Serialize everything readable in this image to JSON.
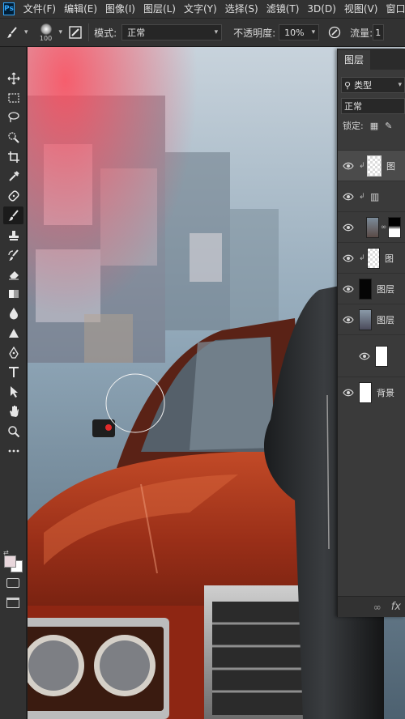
{
  "menu": [
    "文件(F)",
    "编辑(E)",
    "图像(I)",
    "图层(L)",
    "文字(Y)",
    "选择(S)",
    "滤镜(T)",
    "3D(D)",
    "视图(V)",
    "窗口"
  ],
  "app_logo": "Ps",
  "options": {
    "brush_size": "100",
    "mode_label": "模式:",
    "mode_value": "正常",
    "opacity_label": "不透明度:",
    "opacity_value": "10%",
    "flow_label": "流量:",
    "flow_value": "1"
  },
  "layers_panel": {
    "tab": "图层",
    "filter_kind": "类型",
    "blend_mode": "正常",
    "lock_label": "锁定:",
    "layers": [
      {
        "name": "图",
        "selected": true
      },
      {
        "name": "",
        "selected": false
      },
      {
        "name": "",
        "selected": false
      },
      {
        "name": "图",
        "selected": false
      },
      {
        "name": "图层",
        "selected": false
      },
      {
        "name": "图层",
        "selected": false
      },
      {
        "name": "",
        "selected": false
      },
      {
        "name": "背景",
        "selected": false
      }
    ],
    "footer_fx": "fx"
  },
  "colors": {
    "ui_dark": "#323232",
    "panel": "#3a3a3a",
    "accent": "#31a8ff",
    "car_red": "#a2321c"
  },
  "tool_icons": [
    "move-icon",
    "marquee-icon",
    "lasso-icon",
    "quick-select-icon",
    "crop-icon",
    "eyedropper-icon",
    "healing-icon",
    "brush-icon",
    "clone-stamp-icon",
    "history-brush-icon",
    "eraser-icon",
    "gradient-icon",
    "blur-icon",
    "dodge-icon",
    "pen-icon",
    "type-icon",
    "path-select-icon",
    "hand-icon",
    "zoom-icon",
    "more-tools-icon"
  ]
}
